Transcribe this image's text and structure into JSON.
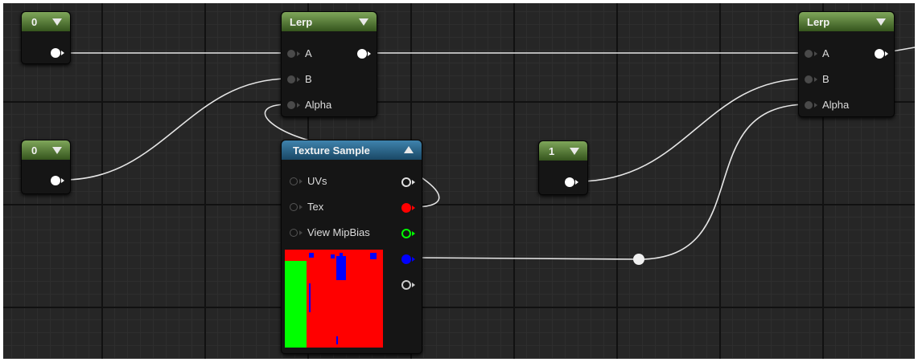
{
  "colors": {
    "header_green": "#5a8a3a",
    "header_blue": "#2a6a93",
    "wire": "#e6e6e6",
    "pin_white": "#ffffff",
    "pin_red": "#ff0000",
    "pin_green": "#00ff00",
    "pin_blue": "#0000ff"
  },
  "constants": [
    {
      "value": "0"
    },
    {
      "value": "0"
    },
    {
      "value": "1"
    }
  ],
  "lerp_nodes": [
    {
      "title": "Lerp",
      "inputs": [
        "A",
        "B",
        "Alpha"
      ]
    },
    {
      "title": "Lerp",
      "inputs": [
        "A",
        "B",
        "Alpha"
      ]
    }
  ],
  "texture_sample": {
    "title": "Texture Sample",
    "inputs": [
      "UVs",
      "Tex",
      "View MipBias"
    ],
    "outputs": [
      "rgb",
      "r",
      "g",
      "b",
      "a"
    ]
  },
  "icons": {
    "collapse": "chevron-down-icon",
    "expand": "chevron-up-icon"
  }
}
